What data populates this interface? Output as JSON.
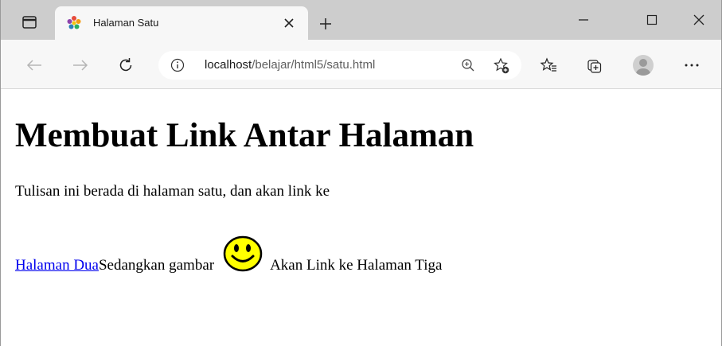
{
  "browser": {
    "tab": {
      "title": "Halaman Satu"
    },
    "address_bar": {
      "host": "localhost",
      "path": "/belajar/html5/satu.html"
    },
    "icons": {
      "tab_actions": "tab-actions-icon",
      "favicon": "page-favicon",
      "tab_close": "close-icon",
      "new_tab": "plus-icon",
      "minimize": "minimize-icon",
      "maximize": "maximize-icon",
      "close_window": "close-icon",
      "back": "arrow-left-icon",
      "forward": "arrow-right-icon",
      "refresh": "refresh-icon",
      "site_info": "info-icon",
      "zoom": "zoom-in-icon",
      "add_favorite": "star-plus-icon",
      "favorites": "favorites-icon",
      "collections": "collections-icon",
      "profile": "avatar",
      "more": "more-icon"
    }
  },
  "page": {
    "heading": "Membuat Link Antar Halaman",
    "paragraph": "Tulisan ini berada di halaman satu, dan akan link ke",
    "link_dua": "Halaman Dua ",
    "text_gambar": "Sedangkan gambar",
    "text_tiga": "Akan Link ke Halaman Tiga",
    "image_icon": "smiley-face-icon"
  },
  "colors": {
    "titlebar": "#cdcdcd",
    "toolbar": "#f7f7f7",
    "link": "#0000ee",
    "smiley_fill": "#ffff00"
  }
}
